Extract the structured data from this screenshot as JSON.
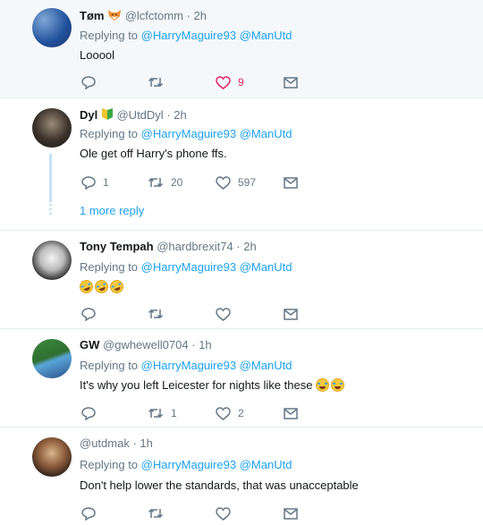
{
  "reply_prefix": "Replying to",
  "tweets": [
    {
      "name": "Tøm",
      "handle": "@lcfctomm",
      "time": "2h",
      "reply_to": [
        "@HarryMaguire93",
        "@ManUtd"
      ],
      "text": "Looool",
      "counts": {
        "reply": "",
        "retweet": "",
        "like": "9"
      },
      "liked": true,
      "badge": "fox-emoji-icon"
    },
    {
      "name": "Dyl",
      "handle": "@UtdDyl",
      "time": "2h",
      "reply_to": [
        "@HarryMaguire93",
        "@ManUtd"
      ],
      "text": "Ole get off Harry's phone ffs.",
      "counts": {
        "reply": "1",
        "retweet": "20",
        "like": "597"
      },
      "badge": "beginner-shield-emoji-icon",
      "more_reply": "1 more reply"
    },
    {
      "name": "Tony Tempah",
      "handle": "@hardbrexit74",
      "time": "2h",
      "reply_to": [
        "@HarryMaguire93",
        "@ManUtd"
      ],
      "text": "",
      "emojis": 3,
      "counts": {
        "reply": "",
        "retweet": "",
        "like": ""
      }
    },
    {
      "name": "GW",
      "handle": "@gwhewell0704",
      "time": "1h",
      "reply_to": [
        "@HarryMaguire93",
        "@ManUtd"
      ],
      "text": "It's why you left Leicester for nights like these",
      "emojis": 2,
      "counts": {
        "reply": "",
        "retweet": "1",
        "like": "2"
      }
    },
    {
      "name": "",
      "handle": "@utdmak",
      "time": "1h",
      "reply_to": [
        "@HarryMaguire93",
        "@ManUtd"
      ],
      "text": "Don't help lower the standards, that was unacceptable",
      "counts": {
        "reply": "",
        "retweet": "",
        "like": ""
      }
    }
  ],
  "colors": {
    "link": "#1da1f2",
    "muted": "#657786",
    "like_active": "#e0245e",
    "thread_line": "#c4e3f7"
  }
}
